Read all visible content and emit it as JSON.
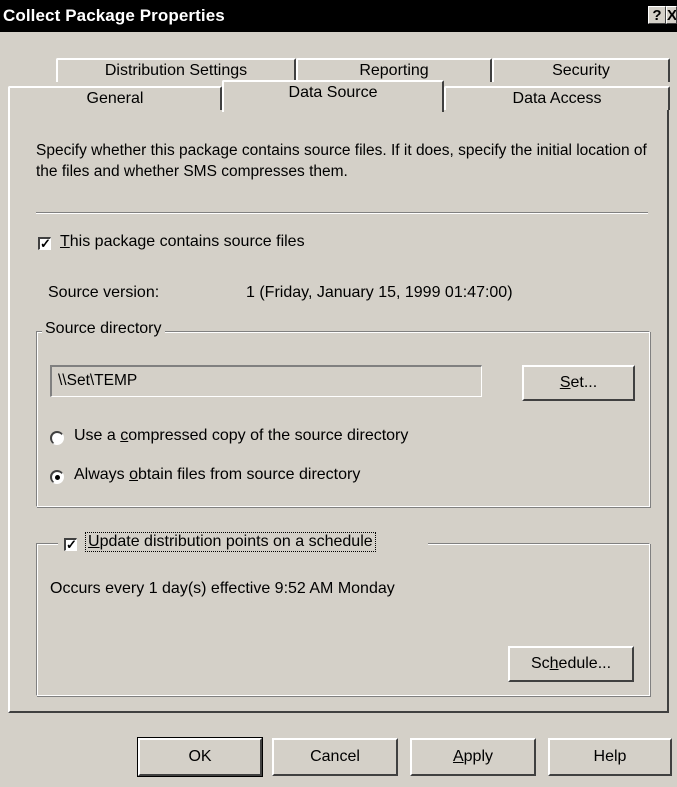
{
  "window": {
    "title": "Collect Package Properties",
    "help_glyph": "?",
    "close_glyph": "X"
  },
  "tabs": {
    "row1": [
      "Distribution Settings",
      "Reporting",
      "Security"
    ],
    "row2": [
      "General",
      "Data Source",
      "Data Access"
    ],
    "selected": "Data Source"
  },
  "description": "Specify whether this package contains source files.  If it does, specify the initial location of the files and whether SMS compresses them.",
  "source_files_checkbox": {
    "label_prefix": "T",
    "label_rest": "his package contains source files",
    "checked": true
  },
  "source_version": {
    "label": "Source version:",
    "value": "1 (Friday, January 15, 1999 01:47:00)"
  },
  "source_directory": {
    "legend": "Source directory",
    "path": "\\\\Set\\TEMP",
    "set_button_prefix": "S",
    "set_button_rest": "et...",
    "radio_compressed": {
      "pre": "Use a ",
      "key": "c",
      "post": "ompressed copy of the source directory",
      "selected": false
    },
    "radio_always": {
      "pre": "Always ",
      "key": "o",
      "post": "btain files from source directory",
      "selected": true
    }
  },
  "schedule_group": {
    "checkbox_key": "U",
    "checkbox_rest": "pdate distribution points on a schedule",
    "checked": true,
    "occurs_text": "Occurs every 1 day(s) effective 9:52 AM Monday",
    "schedule_button_pre": "Sc",
    "schedule_button_key": "h",
    "schedule_button_post": "edule..."
  },
  "buttons": {
    "ok": "OK",
    "cancel": "Cancel",
    "apply_key": "A",
    "apply_rest": "pply",
    "help": "Help"
  }
}
